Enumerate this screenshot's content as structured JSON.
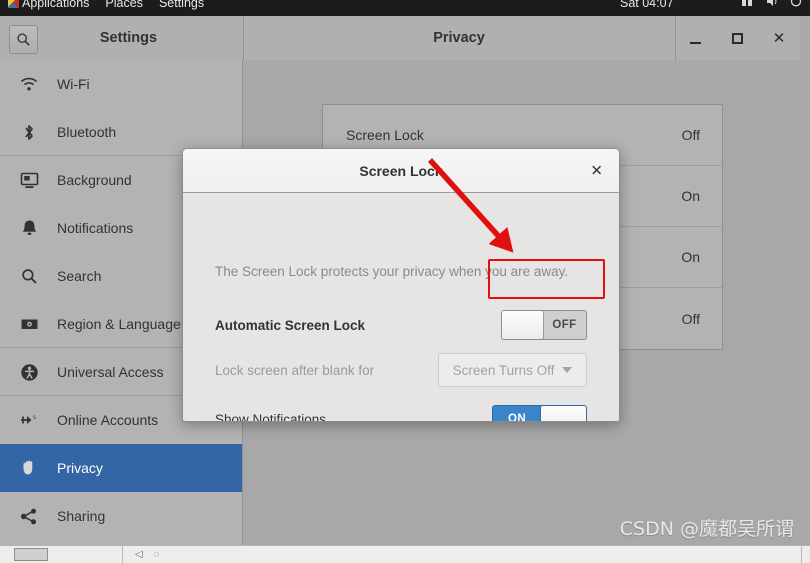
{
  "topbar": {
    "activities": "Applications",
    "places": "Places",
    "app_menu": "Settings",
    "clock": "Sat 04:07",
    "icons": [
      "network-icon",
      "volume-icon",
      "power-icon"
    ]
  },
  "window": {
    "search_icon": "search-icon",
    "left_title": "Settings",
    "right_title": "Privacy",
    "minimize_label": "minimize-icon",
    "maximize_label": "maximize-icon",
    "close_label": "✕"
  },
  "sidebar": {
    "items": [
      {
        "label": "Wi-Fi",
        "icon": "wifi-icon",
        "selected": false
      },
      {
        "label": "Bluetooth",
        "icon": "bluetooth-icon",
        "selected": false
      },
      {
        "label": "Background",
        "icon": "background-icon",
        "selected": false
      },
      {
        "label": "Notifications",
        "icon": "bell-icon",
        "selected": false
      },
      {
        "label": "Search",
        "icon": "search-icon",
        "selected": false
      },
      {
        "label": "Region & Language",
        "icon": "region-icon",
        "selected": false
      },
      {
        "label": "Universal Access",
        "icon": "accessibility-icon",
        "selected": false
      },
      {
        "label": "Online Accounts",
        "icon": "online-accounts-icon",
        "selected": false
      },
      {
        "label": "Privacy",
        "icon": "privacy-hand-icon",
        "selected": true
      },
      {
        "label": "Sharing",
        "icon": "sharing-icon",
        "selected": false
      }
    ]
  },
  "content": {
    "rows": [
      {
        "label": "Screen Lock",
        "value": "Off"
      },
      {
        "label": "",
        "value": "On"
      },
      {
        "label": "",
        "value": "On"
      },
      {
        "label": "",
        "value": "Off"
      }
    ]
  },
  "dialog": {
    "title": "Screen Lock",
    "close_label": "✕",
    "description": "The Screen Lock protects your privacy when you are away.",
    "rows": {
      "automatic_screen_lock": {
        "label": "Automatic Screen Lock",
        "toggle_state": "OFF"
      },
      "lock_after_blank": {
        "label": "Lock screen after blank for",
        "dropdown_value": "Screen Turns Off"
      },
      "show_notifications": {
        "label": "Show Notifications",
        "toggle_state": "ON"
      }
    }
  },
  "annotation": {
    "type": "red-arrow",
    "highlight_target": "automatic-screen-lock-toggle",
    "color": "#e01010"
  },
  "watermark": {
    "text": "CSDN @魔都吴所谓"
  },
  "taskbar": {
    "window_button": "settings-window-button"
  }
}
